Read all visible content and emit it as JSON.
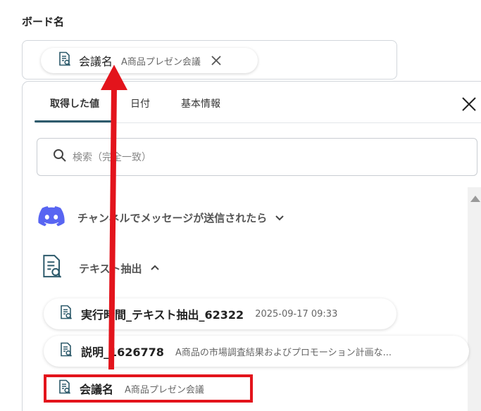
{
  "field": {
    "label": "ボード名"
  },
  "selected_chip": {
    "name": "会議名",
    "value": "A商品プレゼン会議",
    "icon": "document-search-icon"
  },
  "dropdown": {
    "tabs": [
      {
        "label": "取得した値",
        "active": true
      },
      {
        "label": "日付",
        "active": false
      },
      {
        "label": "基本情報",
        "active": false
      }
    ],
    "search": {
      "placeholder": "検索（完全一致）"
    },
    "sections": [
      {
        "title": "チャンネルでメッセージが送信されたら",
        "icon": "discord-icon",
        "expanded": false
      },
      {
        "title": "テキスト抽出",
        "icon": "document-search-icon",
        "expanded": true
      }
    ],
    "items": [
      {
        "name": "実行時間_テキスト抽出_62322",
        "value": "2025-09-17 09:33"
      },
      {
        "name": "説明_1626778",
        "value": "A商品の市場調査結果およびプロモーション計画な..."
      },
      {
        "name": "会議名",
        "value": "A商品プレゼン会議"
      }
    ]
  },
  "colors": {
    "accent": "#2d5a6b",
    "annotation": "#e3141c",
    "discord": "#5865f2"
  }
}
